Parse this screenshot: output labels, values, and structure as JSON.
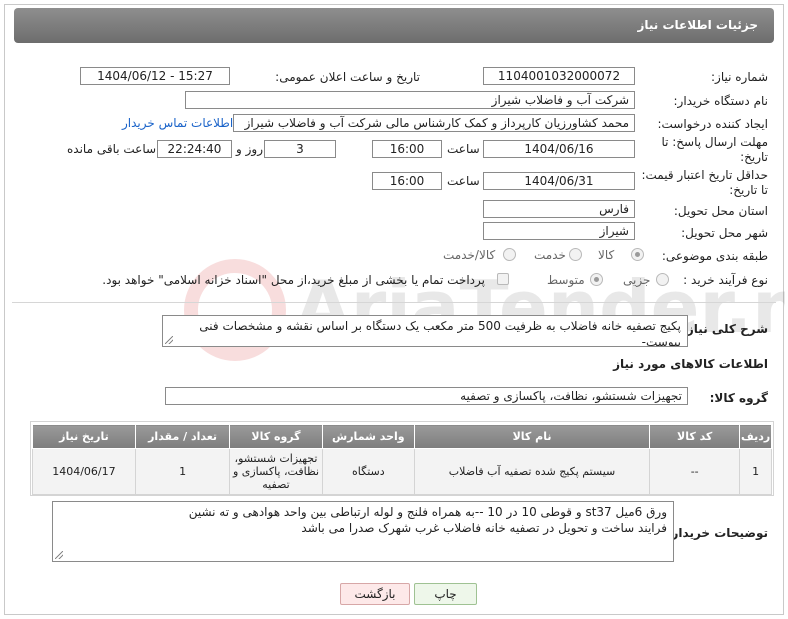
{
  "header": {
    "title": "جزئیات اطلاعات نیاز"
  },
  "fields": {
    "need_number_label": "شماره نیاز:",
    "need_number": "1104001032000072",
    "announce_label": "تاریخ و ساعت اعلان عمومی:",
    "announce_value": "1404/06/12 - 15:27",
    "buyer_label": "نام دستگاه خریدار:",
    "buyer_value": "شرکت آب و فاضلاب شیراز",
    "creator_label": "ایجاد کننده درخواست:",
    "creator_value": "محمد کشاورزیان کارپرداز و کمک کارشناس مالی شرکت آب و فاضلاب شیراز",
    "contact_link": "اطلاعات تماس خریدار",
    "deadline_label_line1": "مهلت ارسال پاسخ: تا",
    "deadline_label_line2": "تاریخ:",
    "deadline_date": "1404/06/16",
    "time_label": "ساعت",
    "deadline_time": "16:00",
    "days_value": "3",
    "days_label": "روز و",
    "remaining_time": "22:24:40",
    "remaining_label": "ساعت باقی مانده",
    "validity_label_line1": "حداقل تاریخ اعتبار قیمت:",
    "validity_label_line2": "تا تاریخ:",
    "validity_date": "1404/06/31",
    "validity_time": "16:00",
    "province_label": "استان محل تحویل:",
    "province_value": "فارس",
    "city_label": "شهر محل تحویل:",
    "city_value": "شیراز",
    "category_label": "طبقه بندی موضوعی:",
    "category_options": [
      "کالا",
      "خدمت",
      "کالا/خدمت"
    ],
    "process_label": "نوع فرآیند خرید :",
    "process_options": [
      "جزیی",
      "متوسط"
    ],
    "payment_note": "پرداخت تمام یا بخشی از مبلغ خرید،از محل \"اسناد خزانه اسلامی\" خواهد بود."
  },
  "description": {
    "label": "شرح کلی نیاز:",
    "text": "پکیج تصفیه خانه فاضلاب به ظرفیت 500 متر مکعب یک دستگاه بر اساس نقشه و مشخصات فنی پیوست-"
  },
  "goods": {
    "section_title": "اطلاعات کالاهای مورد نیاز",
    "group_label": "گروه کالا:",
    "group_value": "تجهیزات شستشو، نظافت، پاکسازی و تصفیه",
    "columns": [
      "ردیف",
      "کد کالا",
      "نام کالا",
      "واحد شمارش",
      "گروه کالا",
      "تعداد / مقدار",
      "تاریخ نیاز"
    ],
    "rows": [
      {
        "row": "1",
        "code": "--",
        "name": "سیستم پکیج شده تصفیه آب فاضلاب",
        "unit": "دستگاه",
        "group": "تجهیزات شستشو، نظافت، پاکسازی و تصفیه",
        "qty": "1",
        "date": "1404/06/17"
      }
    ]
  },
  "buyer_notes": {
    "label": "توضیحات خریدار:",
    "line1": "ورق 6میل st37 و قوطی 10 در 10 --به همراه فلنج و لوله ارتباطی بین واحد هوادهی و ته نشین",
    "line2": "فرایند ساخت و تحویل  در تصفیه خانه فاضلاب غرب شهرک صدرا می باشد"
  },
  "buttons": {
    "print": "چاپ",
    "back": "بازگشت"
  },
  "watermark": {
    "text": "AriaTender.net"
  }
}
